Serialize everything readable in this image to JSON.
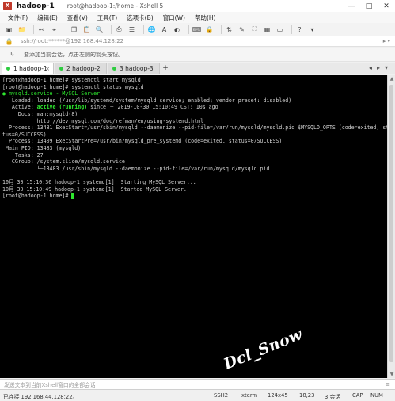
{
  "titlebar": {
    "name": "hadoop-1",
    "subtitle": "root@hadoop-1:/home - Xshell 5",
    "min": "—",
    "max": "□",
    "close": "✕"
  },
  "menu": [
    "文件(F)",
    "编辑(E)",
    "查看(V)",
    "工具(T)",
    "选项卡(B)",
    "窗口(W)",
    "帮助(H)"
  ],
  "address": {
    "text": "ssh://root:******@192.168.44.128:22",
    "right": "▸ ▾"
  },
  "notice": {
    "text": "要添加当前会话，点击左侧的箭头按钮。"
  },
  "tabs": [
    {
      "label": "1 hadoop-1",
      "active": true
    },
    {
      "label": "2 hadoop-2",
      "active": false
    },
    {
      "label": "3 hadoop-3",
      "active": false
    }
  ],
  "tab_add": "+",
  "terminal": {
    "lines": [
      "[root@hadoop-1 home]# systemctl start mysqld",
      "[root@hadoop-1 home]# systemctl status mysqld",
      "● mysqld.service - MySQL Server",
      "   Loaded: loaded (/usr/lib/systemd/system/mysqld.service; enabled; vendor preset: disabled)",
      "   Active: active (running) since 三 2019-10-30 15:10:49 CST; 10s ago",
      "     Docs: man:mysqld(8)",
      "           http://dev.mysql.com/doc/refman/en/using-systemd.html",
      "  Process: 13481 ExecStart=/usr/sbin/mysqld --daemonize --pid-file=/var/run/mysqld/mysqld.pid $MYSQLD_OPTS (code=exited, sta",
      "tus=0/SUCCESS)",
      "  Process: 13409 ExecStartPre=/usr/bin/mysqld_pre_systemd (code=exited, status=0/SUCCESS)",
      " Main PID: 13483 (mysqld)",
      "    Tasks: 27",
      "   CGroup: /system.slice/mysqld.service",
      "           └─13483 /usr/sbin/mysqld --daemonize --pid-file=/var/run/mysqld/mysqld.pid",
      "",
      "10月 30 15:10:36 hadoop-1 systemd[1]: Starting MySQL Server...",
      "10月 30 15:10:49 hadoop-1 systemd[1]: Started MySQL Server.",
      "[root@hadoop-1 home]# "
    ],
    "watermark": "Dcl_Snow"
  },
  "input_placeholder": "发送文本到当前Xshell窗口的全部会话",
  "status": {
    "connection": "已连接 192.168.44.128:22。",
    "protocol": "SSH2",
    "term": "xterm",
    "size": "124x45",
    "pos": "18,23",
    "sessions": "3 会话",
    "caps": "CAP",
    "num": "NUM"
  }
}
